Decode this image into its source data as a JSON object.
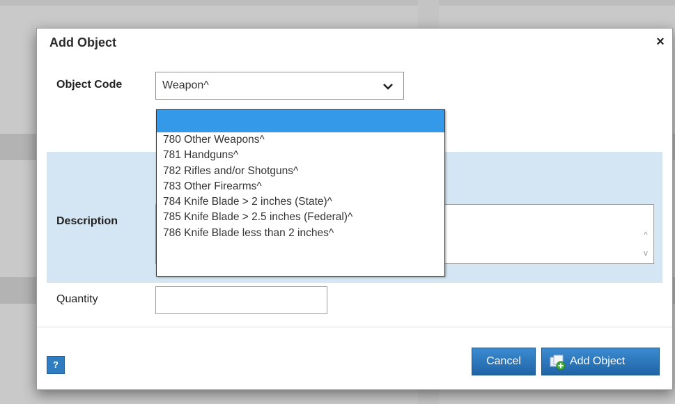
{
  "dialog": {
    "title": "Add Object",
    "close_glyph": "×"
  },
  "form": {
    "object_code_label": "Object Code",
    "object_code_value": "Weapon^",
    "description_label": "Description",
    "quantity_label": "Quantity",
    "quantity_value": ""
  },
  "dropdown": {
    "options": [
      "",
      "780 Other Weapons^",
      "781 Handguns^",
      "782 Rifles and/or Shotguns^",
      "783 Other Firearms^",
      "784 Knife Blade > 2 inches (State)^",
      "785 Knife Blade > 2.5 inches (Federal)^",
      "786 Knife Blade less than 2 inches^"
    ],
    "selected_index": 0
  },
  "footer": {
    "help_label": "?",
    "cancel_label": "Cancel",
    "add_label": "Add Object"
  },
  "icons": {
    "close": "close-icon",
    "chevron": "chevron-down-icon",
    "add": "add-object-icon",
    "scroll_up": "scroll-up-icon",
    "scroll_down": "scroll-down-icon"
  },
  "colors": {
    "accent": "#1f64a6",
    "band": "#d4e6f3",
    "selected_option": "#3399e8"
  }
}
